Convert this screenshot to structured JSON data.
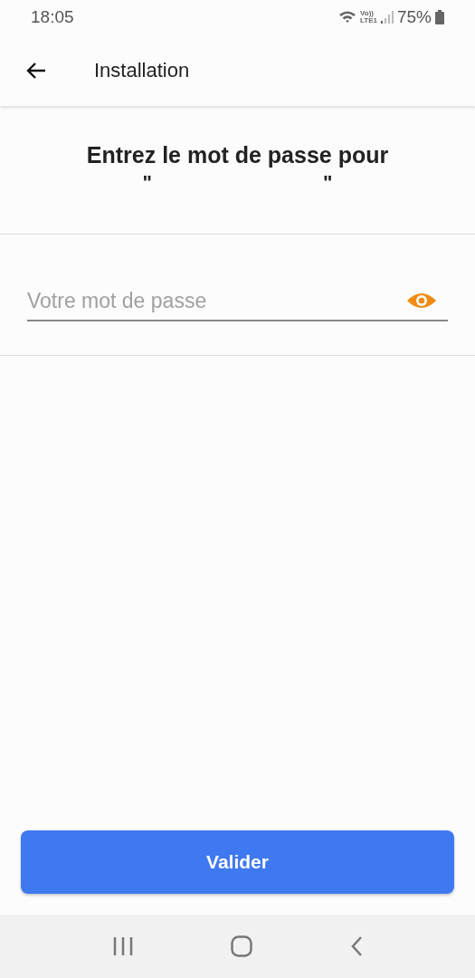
{
  "status_bar": {
    "time": "18:05",
    "volte": "Vo))",
    "network": "LTE1",
    "battery": "75%"
  },
  "app_bar": {
    "title": "Installation"
  },
  "prompt": {
    "text": "Entrez le mot de passe pour",
    "quotes": [
      "\"",
      "\""
    ]
  },
  "password_field": {
    "placeholder": "Votre mot de passe"
  },
  "submit_button": {
    "label": "Valider"
  }
}
